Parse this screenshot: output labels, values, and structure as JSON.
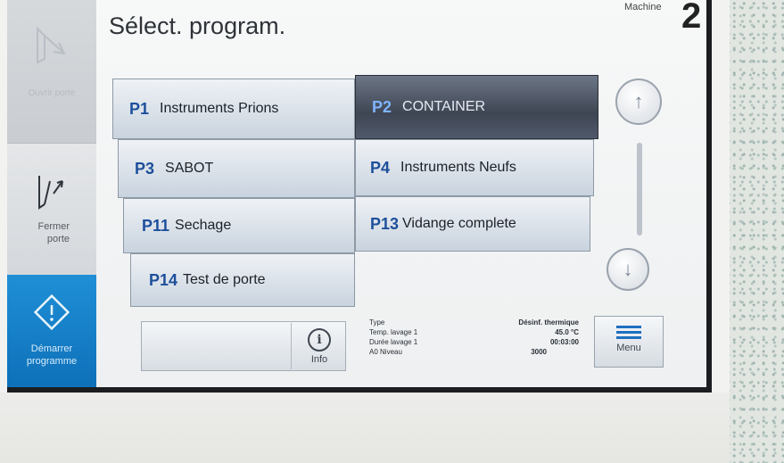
{
  "header": {
    "title": "Sélect. program.",
    "machine_label": "Machine",
    "machine_number": "2"
  },
  "sidebar": {
    "open_door": {
      "label": "Ouvrir porte",
      "icon": "door-open-icon",
      "enabled": false
    },
    "close_door": {
      "label": "Fermer porte",
      "icon": "door-close-icon"
    },
    "start": {
      "label": "Démarrer programme",
      "icon": "start-diamond-icon"
    }
  },
  "programs": [
    {
      "code": "P1",
      "name": "Instruments Prions",
      "selected": false
    },
    {
      "code": "P2",
      "name": "CONTAINER",
      "selected": true
    },
    {
      "code": "P3",
      "name": "SABOT",
      "selected": false
    },
    {
      "code": "P4",
      "name": "Instruments Neufs",
      "selected": false
    },
    {
      "code": "P11",
      "name": "Sechage",
      "selected": false
    },
    {
      "code": "P13",
      "name": "Vidange complete",
      "selected": false
    },
    {
      "code": "P14",
      "name": "Test de porte",
      "selected": false
    }
  ],
  "scroll": {
    "up_icon": "arrow-up-icon",
    "down_icon": "arrow-down-icon"
  },
  "info": {
    "label": "Info",
    "icon": "info-icon"
  },
  "params": {
    "type_label": "Type",
    "type_value": "Désinf. thermique",
    "temp_label": "Temp. lavage 1",
    "temp_value": "45.0  °C",
    "duration_label": "Durée lavage 1",
    "duration_value": "00:03:00",
    "a0_label": "A0 Niveau",
    "a0_value": "3000"
  },
  "menu": {
    "label": "Menu",
    "icon": "menu-icon"
  },
  "colors": {
    "accent_blue": "#0d6fb8",
    "program_code": "#1d4f9b",
    "selected_bg": "#3e4654"
  }
}
